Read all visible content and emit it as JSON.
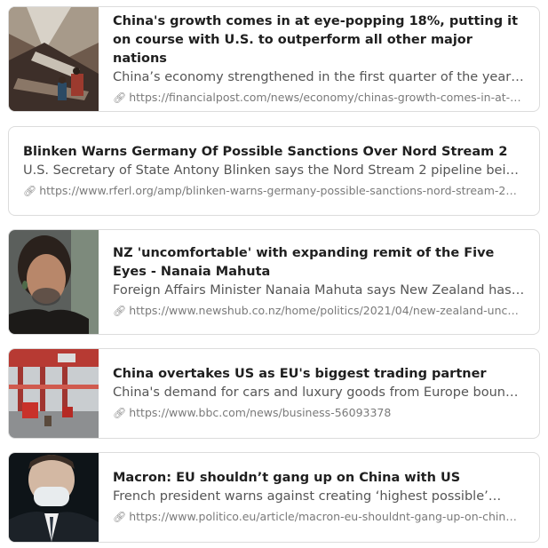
{
  "cards": [
    {
      "title": "China's growth comes in at eye-popping 18%, putting it on course with U.S. to outperform all other major nations",
      "description": "China’s economy strengthened in the first quarter of the year a…",
      "url": "https://financialpost.com/news/economy/chinas-growth-comes-in-at-…",
      "thumbnail": "escalator-mall-photo"
    },
    {
      "title": "Blinken Warns Germany Of Possible Sanctions Over Nord Stream 2",
      "description": "U.S. Secretary of State Antony Blinken says the Nord Stream 2 pipeline being…",
      "url": "https://www.rferl.org/amp/blinken-warns-germany-possible-sanctions-nord-stream-2…"
    },
    {
      "title": "NZ 'uncomfortable' with expanding remit of the Five Eyes - Nanaia Mahuta",
      "description": "Foreign Affairs Minister Nanaia Mahuta says New Zealand has…",
      "url": "https://www.newshub.co.nz/home/politics/2021/04/new-zealand-unc…",
      "thumbnail": "portrait-photo"
    },
    {
      "title": "China overtakes US as EU's biggest trading partner",
      "description": "China's demand for cars and luxury goods from Europe bounce…",
      "url": "https://www.bbc.com/news/business-56093378",
      "thumbnail": "shipping-port-photo"
    },
    {
      "title": "Macron: EU shouldn’t gang up on China with US",
      "description": "French president warns against creating ‘highest possible’…",
      "url": "https://www.politico.eu/article/macron-eu-shouldnt-gang-up-on-chin…",
      "thumbnail": "masked-man-photo"
    }
  ],
  "icons": {
    "link": "link-icon"
  },
  "colors": {
    "title": "#1f1f1f",
    "description": "#555555",
    "url": "#7a7a7a",
    "border": "#dcdcdc"
  }
}
